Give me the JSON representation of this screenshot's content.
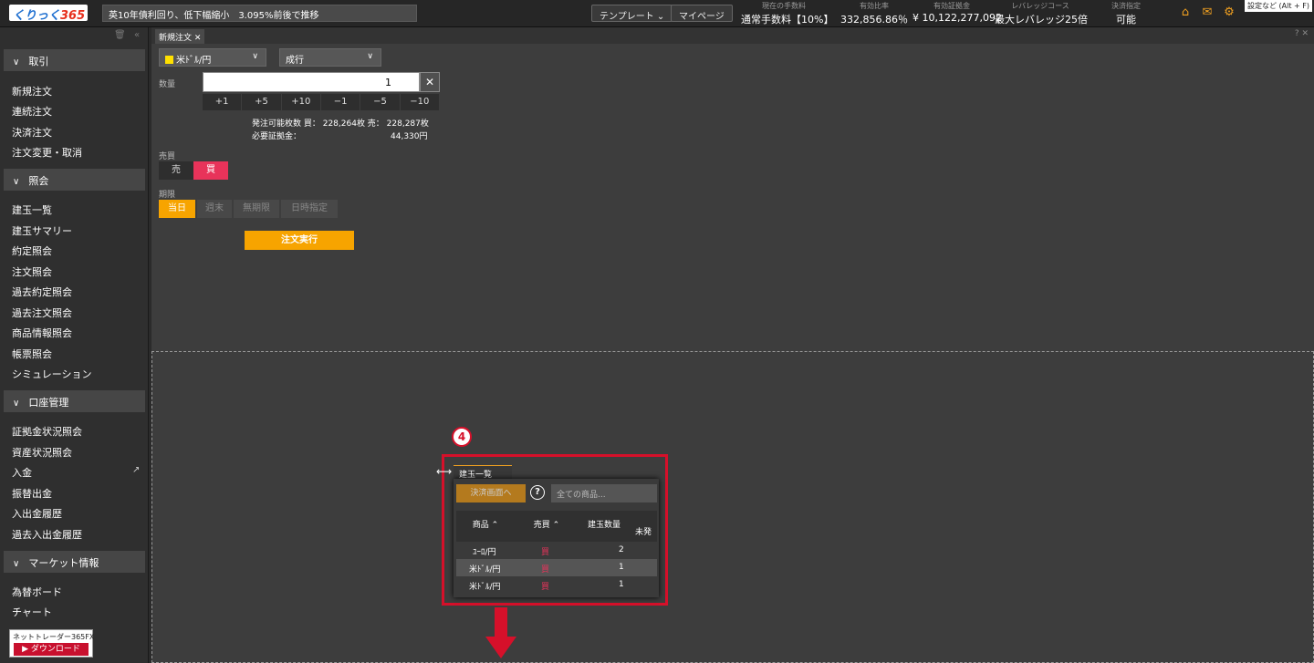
{
  "topbar": {
    "logo_main": "くりっく",
    "logo_num": "365",
    "ticker": "英10年債利回り、低下幅縮小　3.095%前後で推移",
    "template_label": "テンプレート ⌄",
    "mypage_label": "マイページ",
    "stats": [
      {
        "label": "現在の手数料",
        "value": "通常手数料【10%】"
      },
      {
        "label": "有効比率",
        "value": "332,856.86％"
      },
      {
        "label": "有効証拠金",
        "value": "¥ 10,122,277,092"
      },
      {
        "label": "レバレッジコース",
        "value": "最大レバレッジ25倍"
      },
      {
        "label": "決済指定",
        "value": "可能"
      }
    ],
    "tooltip": "設定など (Alt + F)"
  },
  "sidebar": {
    "sections": [
      {
        "title": "取引",
        "items": [
          "新規注文",
          "連続注文",
          "決済注文",
          "注文変更・取消"
        ]
      },
      {
        "title": "照会",
        "items": [
          "建玉一覧",
          "建玉サマリー",
          "約定照会",
          "注文照会",
          "過去約定照会",
          "過去注文照会",
          "商品情報照会",
          "帳票照会",
          "シミュレーション"
        ]
      },
      {
        "title": "口座管理",
        "items": [
          "証拠金状況照会",
          "資産状況照会",
          "入金",
          "振替出金",
          "入出金履歴",
          "過去入出金履歴"
        ]
      },
      {
        "title": "マーケット情報",
        "items": [
          "為替ボード",
          "チャート"
        ]
      }
    ],
    "download_title": "ネットトレーダー365FX",
    "download_button": "ダウンロード"
  },
  "order": {
    "tab_label": "新規注文 ✕",
    "symbol": "米ﾄﾞﾙ/円",
    "order_type": "成行",
    "qty_label": "数量",
    "qty_value": "1",
    "steps": [
      "+1",
      "+5",
      "+10",
      "−1",
      "−5",
      "−10"
    ],
    "avail_text": "発注可能枚数 買： 228,264枚 売： 228,287枚",
    "margin_label": "必要証拠金：",
    "margin_value": "44,330円",
    "side_label": "売買",
    "sell": "売",
    "buy": "買",
    "term_label": "期限",
    "terms": [
      "当日",
      "週末",
      "無期限",
      "日時指定"
    ],
    "exec": "注文実行"
  },
  "positions": {
    "badge": "4",
    "tab": "建玉一覧",
    "pay_button": "決済画面へ",
    "help": "?",
    "filter_placeholder": "全ての商品...",
    "headers": [
      "商品 ⌃",
      "売買 ⌃",
      "建玉数量",
      "未発"
    ],
    "rows": [
      {
        "product": "ﾕｰﾛ/円",
        "side": "買",
        "qty": "2"
      },
      {
        "product": "米ﾄﾞﾙ/円",
        "side": "買",
        "qty": "1"
      },
      {
        "product": "米ﾄﾞﾙ/円",
        "side": "買",
        "qty": "1"
      }
    ],
    "colors": {
      "accent": "#f7a400",
      "buy_red": "#e8335a",
      "highlight": "#d6102a"
    }
  }
}
